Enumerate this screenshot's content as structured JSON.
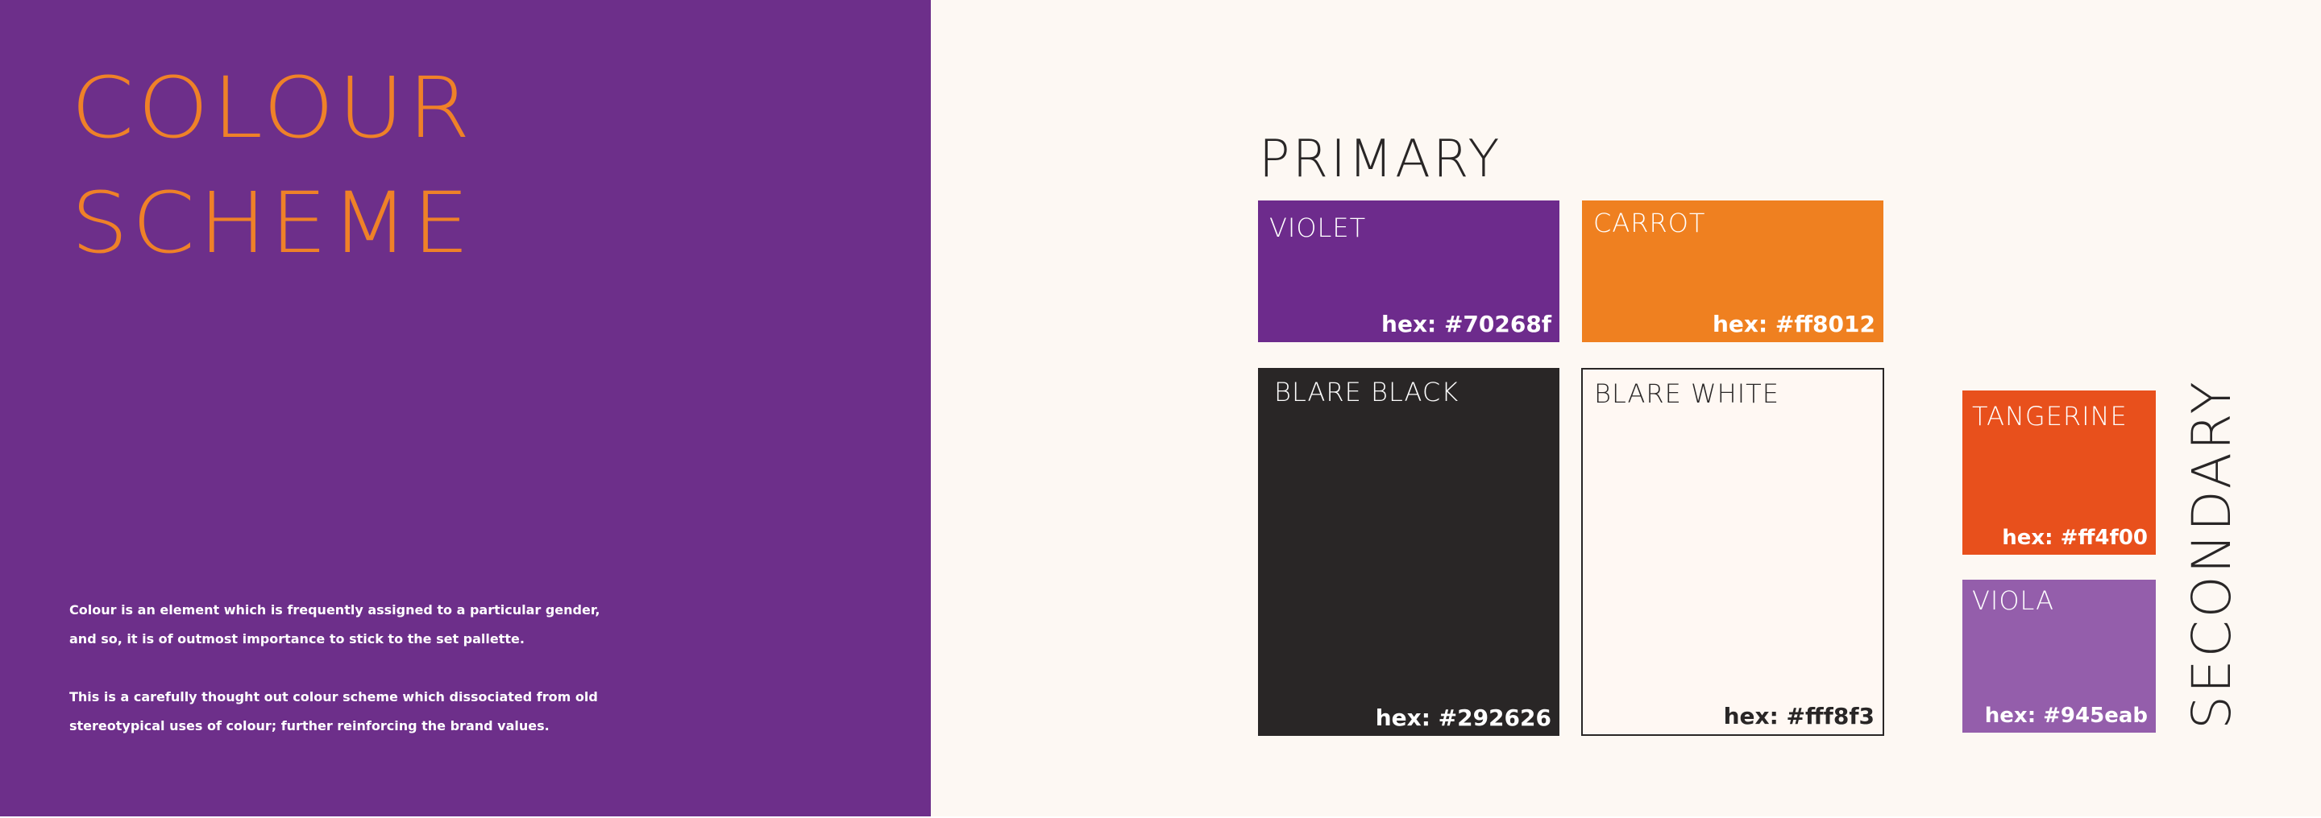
{
  "title": {
    "line1": "COLOUR",
    "line2": "SCHEME"
  },
  "description": {
    "paragraph1_line1": "Colour is an element which is frequently assigned to a particular gender,",
    "paragraph1_line2": "and so, it is of outmost importance to stick to the set pallette.",
    "paragraph2_line1": "This is a carefully thought out colour scheme which dissociated from old",
    "paragraph2_line2": "stereotypical uses of colour; further reinforcing the brand values."
  },
  "primary": {
    "label": "PRIMARY",
    "swatches": [
      {
        "name": "VIOLET",
        "hex_label": "hex: #70268f",
        "color": "#6d2b8c",
        "text_color": "#ffffff"
      },
      {
        "name": "CARROT",
        "hex_label": "hex: #ff8012",
        "color": "#ef8020",
        "text_color": "#ffffff"
      },
      {
        "name": "BLARE BLACK",
        "hex_label": "hex: #292626",
        "color": "#292626",
        "text_color": "#ffffff"
      },
      {
        "name": "BLARE WHITE",
        "hex_label": "hex: #fff8f3",
        "color": "#fff8f3",
        "text_color": "#292626"
      }
    ]
  },
  "secondary": {
    "label": "SECONDARY",
    "swatches": [
      {
        "name": "TANGERINE",
        "hex_label": "hex: #ff4f00",
        "color": "#e8501c",
        "text_color": "#ffffff"
      },
      {
        "name": "VIOLA",
        "hex_label": "hex: #945eab",
        "color": "#945eab",
        "text_color": "#ffffff"
      }
    ]
  }
}
